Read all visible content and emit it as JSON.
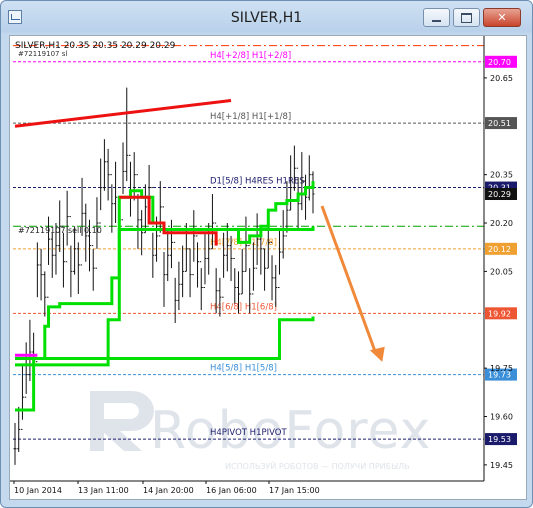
{
  "window": {
    "title": "SILVER,H1"
  },
  "info": {
    "header": "SILVER,H1  20.35 20.35 20.29 20.29",
    "order_line_top": "#72119107 sl",
    "order_line_mid": "#72119107 sell 0.10"
  },
  "watermark": {
    "brand": "RoboForex",
    "slogan": "ИСПОЛЬЗУЙ РОБОТОВ — ПОЛУЧИ ПРИБЫЛЬ"
  },
  "colors": {
    "candles": "#111111",
    "green": "#00e000",
    "red": "#ee1111",
    "magenta": "#ff00ff",
    "arrow": "#f08a3a",
    "badge_bg": "#666666"
  },
  "chart_data": {
    "type": "line",
    "title": "SILVER,H1",
    "ylim": [
      19.4,
      20.78
    ],
    "y_ticks": [
      {
        "value": 20.65,
        "label": "20.65"
      },
      {
        "value": 20.35,
        "label": "20.35"
      },
      {
        "value": 20.2,
        "label": "20.20"
      },
      {
        "value": 20.05,
        "label": "20.05"
      },
      {
        "value": 19.75,
        "label": "19.75"
      },
      {
        "value": 19.6,
        "label": "19.60"
      },
      {
        "value": 19.45,
        "label": "19.45"
      }
    ],
    "x_tick_labels": [
      "10 Jan 2014",
      "13 Jan 11:00",
      "14 Jan 20:00",
      "16 Jan 06:00",
      "17 Jan 15:00"
    ],
    "levels": [
      {
        "value": 20.7,
        "label": "H4[+2/8] H1[+2/8]",
        "price": "20.70",
        "color": "#ff00ff",
        "badge": "#ff00ff"
      },
      {
        "value": 20.51,
        "label": "H4[+1/8] H1[+1/8]",
        "price": "20.51",
        "color": "#555555",
        "badge": "#555555"
      },
      {
        "value": 20.31,
        "label": "D1[5/8] H4RES H1RES",
        "price": "20.31",
        "color": "#1b1b6b",
        "badge": "#1b1b6b"
      },
      {
        "value": 20.12,
        "label": "H4[7/8] H1[7/8]",
        "price": "20.12",
        "color": "#f0a030",
        "badge": "#f0a030"
      },
      {
        "value": 19.92,
        "label": "H4[6/8] H1[6/8]",
        "price": "19.92",
        "color": "#ee5533",
        "badge": "#ee5533"
      },
      {
        "value": 19.73,
        "label": "H4[5/8] H1[5/8]",
        "price": "19.73",
        "color": "#3a8fd8",
        "badge": "#3a8fd8"
      },
      {
        "value": 19.53,
        "label": "H4PIVOT H1PIVOT",
        "price": "19.53",
        "color": "#1b1b6b",
        "badge": "#1b1b6b"
      }
    ],
    "current_price": {
      "value": 20.29,
      "label": "20.29"
    },
    "order_levels": [
      {
        "value": 20.75,
        "label": "#72119107 sl",
        "color": "#ff3300"
      },
      {
        "value": 20.19,
        "label": "#72119107 sell 0.10",
        "color": "#00a000"
      }
    ],
    "trendline": {
      "from": 20.5,
      "to": 20.58,
      "color": "#ee1111"
    },
    "series": [
      {
        "close": [
          19.5,
          19.56,
          19.66,
          19.73,
          19.8,
          19.77,
          20.07,
          20.04,
          19.97,
          20.15,
          20.1,
          20.13,
          20.19,
          20.08,
          20.22,
          20.05,
          20.12,
          20.07,
          20.23,
          20.16,
          20.13,
          20.06,
          20.2,
          20.31,
          20.39,
          20.35,
          20.26,
          20.28,
          20.21,
          20.36,
          20.41,
          20.3,
          20.35,
          20.21,
          20.17,
          20.25,
          20.31,
          20.1,
          20.16,
          20.25,
          20.04,
          20.1,
          20.14,
          19.96,
          20.01,
          20.05,
          20.12,
          20.04,
          20.16,
          20.08,
          20.0,
          20.09,
          20.12,
          20.2,
          19.99,
          19.97,
          20.1,
          20.13,
          20.09,
          20.0,
          19.98,
          20.05,
          20.13,
          19.98,
          20.06,
          20.15,
          20.12,
          20.06,
          20.14,
          20.03,
          20.0,
          20.11,
          20.16,
          20.24,
          20.31,
          20.37,
          20.26,
          20.33,
          20.28,
          20.35,
          20.29
        ],
        "high": [
          19.58,
          19.63,
          19.76,
          19.83,
          19.9,
          19.86,
          20.14,
          20.12,
          20.05,
          20.22,
          20.17,
          20.2,
          20.27,
          20.17,
          20.3,
          20.13,
          20.19,
          20.14,
          20.34,
          20.26,
          20.21,
          20.12,
          20.28,
          20.4,
          20.46,
          20.43,
          20.32,
          20.39,
          20.28,
          20.45,
          20.62,
          20.39,
          20.42,
          20.29,
          20.24,
          20.32,
          20.38,
          20.17,
          20.22,
          20.33,
          20.11,
          20.18,
          20.21,
          20.03,
          20.08,
          20.13,
          20.2,
          20.12,
          20.24,
          20.14,
          20.06,
          20.17,
          20.2,
          20.29,
          20.06,
          20.03,
          20.17,
          20.2,
          20.16,
          20.06,
          20.05,
          20.12,
          20.22,
          20.06,
          20.14,
          20.23,
          20.18,
          20.12,
          20.21,
          20.1,
          20.07,
          20.18,
          20.24,
          20.33,
          20.41,
          20.44,
          20.34,
          20.42,
          20.35,
          20.41,
          20.36
        ],
        "low": [
          19.45,
          19.49,
          19.59,
          19.67,
          19.71,
          19.69,
          19.97,
          19.96,
          19.91,
          20.07,
          20.03,
          20.04,
          20.11,
          20.0,
          20.13,
          19.97,
          20.04,
          19.98,
          20.16,
          20.08,
          20.05,
          19.99,
          20.12,
          20.24,
          20.3,
          20.27,
          20.17,
          20.2,
          20.14,
          20.29,
          20.33,
          20.22,
          20.27,
          20.12,
          20.1,
          20.17,
          20.23,
          20.03,
          20.08,
          20.17,
          19.94,
          20.02,
          20.06,
          19.89,
          19.93,
          19.97,
          20.05,
          19.97,
          20.08,
          20.0,
          19.93,
          20.01,
          20.04,
          20.12,
          19.92,
          19.91,
          20.03,
          20.05,
          20.02,
          19.95,
          19.92,
          19.98,
          20.05,
          19.92,
          19.99,
          20.07,
          20.04,
          19.99,
          20.06,
          19.96,
          19.94,
          20.04,
          20.09,
          20.17,
          20.24,
          20.3,
          20.18,
          20.24,
          20.21,
          20.27,
          20.23
        ]
      }
    ],
    "indicator_lines": [
      {
        "color": "#00e000",
        "points": [
          [
            0,
            19.62
          ],
          [
            3,
            19.62
          ],
          [
            5,
            19.78
          ],
          [
            8,
            19.88
          ],
          [
            9,
            19.94
          ],
          [
            12,
            19.95
          ],
          [
            24,
            19.95
          ],
          [
            26,
            20.03
          ],
          [
            28,
            20.28
          ],
          [
            31,
            20.3
          ],
          [
            33,
            20.3
          ],
          [
            34,
            20.28
          ],
          [
            37,
            20.2
          ],
          [
            40,
            20.18
          ],
          [
            55,
            20.18
          ],
          [
            60,
            20.14
          ],
          [
            63,
            20.16
          ],
          [
            66,
            20.19
          ],
          [
            68,
            20.24
          ],
          [
            70,
            20.26
          ],
          [
            73,
            20.27
          ],
          [
            76,
            20.29
          ],
          [
            78,
            20.31
          ],
          [
            80,
            20.33
          ]
        ]
      },
      {
        "color": "#00e000",
        "points": [
          [
            0,
            19.76
          ],
          [
            12,
            19.76
          ],
          [
            24,
            19.76
          ],
          [
            25,
            19.9
          ],
          [
            28,
            20.18
          ],
          [
            35,
            20.18
          ],
          [
            45,
            20.18
          ],
          [
            60,
            20.18
          ],
          [
            70,
            20.18
          ],
          [
            80,
            20.19
          ]
        ]
      },
      {
        "color": "#00e000",
        "points": [
          [
            0,
            19.78
          ],
          [
            70,
            19.78
          ],
          [
            71,
            19.9
          ],
          [
            80,
            19.91
          ]
        ]
      },
      {
        "color": "#ee1111",
        "points": [
          [
            28,
            20.28
          ],
          [
            34,
            20.28
          ],
          [
            36,
            20.2
          ],
          [
            39,
            20.2
          ],
          [
            40,
            20.17
          ],
          [
            45,
            20.17
          ],
          [
            53,
            20.17
          ],
          [
            54,
            20.13
          ]
        ]
      },
      {
        "color": "#ff00ff",
        "points": [
          [
            0,
            19.79
          ],
          [
            6,
            19.79
          ]
        ]
      }
    ]
  }
}
